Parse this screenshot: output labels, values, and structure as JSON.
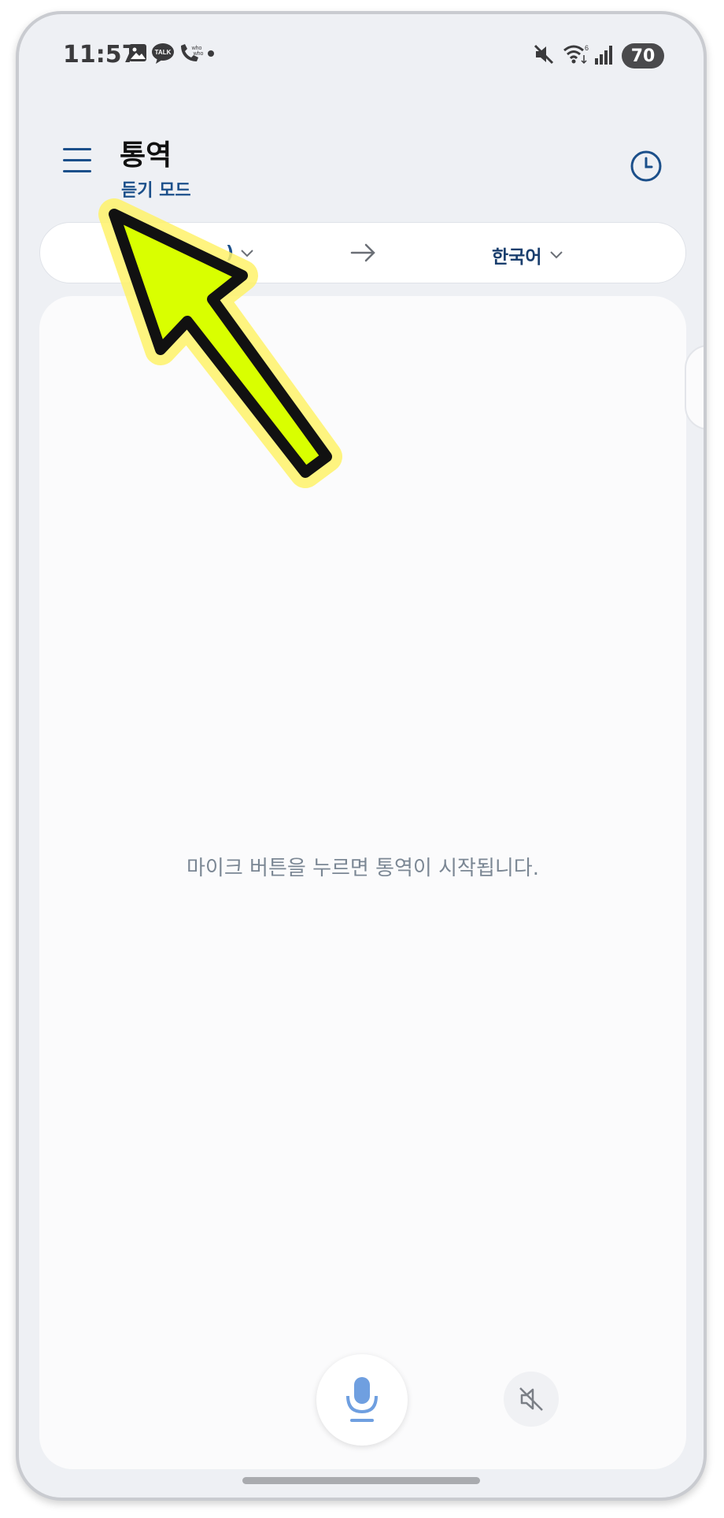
{
  "status_bar": {
    "time": "11:57",
    "battery": "70",
    "notification_icons": [
      "gallery-icon",
      "kakaotalk-icon",
      "whowho-icon",
      "dot-icon"
    ],
    "system_icons": [
      "mute-icon",
      "wifi-icon",
      "signal-icon"
    ]
  },
  "app_bar": {
    "title": "통역",
    "subtitle": "듣기 모드",
    "menu_icon": "hamburger-icon",
    "history_icon": "clock-icon"
  },
  "language_bar": {
    "source_label": ")",
    "target_label": "한국어",
    "swap_icon": "arrow-right-icon",
    "dropdown_icon": "chevron-down-icon"
  },
  "content": {
    "hint": "마이크 버튼을 누르면 통역이 시작됩니다."
  },
  "controls": {
    "mic_icon": "microphone-icon",
    "mute_icon": "speaker-muted-icon"
  },
  "annotation": {
    "arrow_color": "#d9ff00",
    "arrow_glow": "#fff36a"
  },
  "colors": {
    "accent": "#1b4f8a",
    "mic": "#6f9fe0",
    "background": "#eef0f4"
  }
}
